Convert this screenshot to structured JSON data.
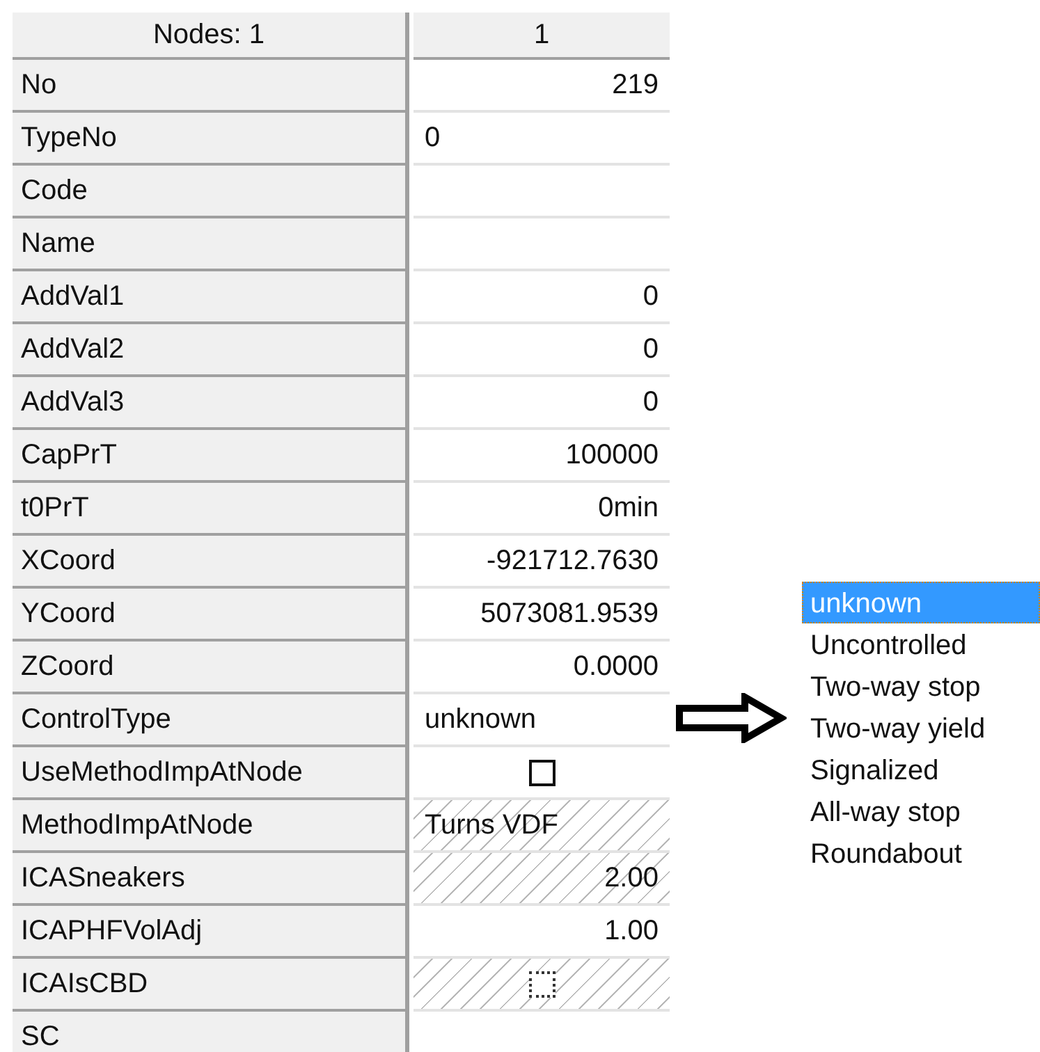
{
  "grid": {
    "header_label": "Nodes: 1",
    "header_value": "1",
    "rows": [
      {
        "label": "No",
        "value": "219",
        "kind": "number",
        "readonly": false
      },
      {
        "label": "TypeNo",
        "value": "0",
        "kind": "text",
        "readonly": false
      },
      {
        "label": "Code",
        "kind": "text"
      },
      {
        "label": "Name",
        "kind": "text"
      },
      {
        "label": "AddVal1",
        "value": "0",
        "kind": "number",
        "readonly": false
      },
      {
        "label": "AddVal2",
        "value": "0",
        "kind": "number",
        "readonly": false
      },
      {
        "label": "AddVal3",
        "value": "0",
        "kind": "number",
        "readonly": false
      },
      {
        "label": "CapPrT",
        "value": "100000",
        "kind": "number",
        "readonly": false
      },
      {
        "label": "t0PrT",
        "value": "0min",
        "kind": "number",
        "readonly": false
      },
      {
        "label": "XCoord",
        "value": "-921712.7630",
        "kind": "number",
        "readonly": false
      },
      {
        "label": "YCoord",
        "value": "5073081.9539",
        "kind": "number",
        "readonly": false
      },
      {
        "label": "ZCoord",
        "value": "0.0000",
        "kind": "number",
        "readonly": false
      },
      {
        "label": "ControlType",
        "value": "unknown",
        "kind": "text",
        "readonly": false
      },
      {
        "label": "UseMethodImpAtNode",
        "kind": "checkbox",
        "checked": false,
        "readonly": false
      },
      {
        "label": "MethodImpAtNode",
        "value": "Turns VDF",
        "kind": "text",
        "readonly": true
      },
      {
        "label": "ICASneakers",
        "value": "2.00",
        "kind": "number",
        "readonly": true
      },
      {
        "label": "ICAPHFVolAdj",
        "value": "1.00",
        "kind": "number",
        "readonly": false
      },
      {
        "label": "ICAIsCBD",
        "kind": "checkbox",
        "checked": false,
        "readonly": true
      },
      {
        "label": "SC",
        "kind": "text"
      }
    ]
  },
  "options": [
    {
      "label": "unknown",
      "selected": true
    },
    {
      "label": "Uncontrolled",
      "selected": false
    },
    {
      "label": "Two-way stop",
      "selected": false
    },
    {
      "label": "Two-way yield",
      "selected": false
    },
    {
      "label": "Signalized",
      "selected": false
    },
    {
      "label": "All-way stop",
      "selected": false
    },
    {
      "label": "Roundabout",
      "selected": false
    }
  ]
}
